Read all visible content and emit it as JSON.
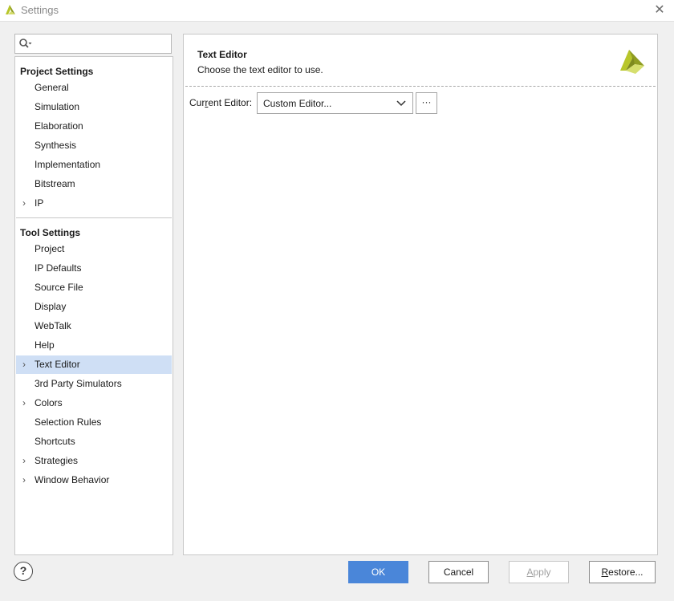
{
  "window": {
    "title": "Settings"
  },
  "search": {
    "placeholder": ""
  },
  "project_settings": {
    "header": "Project Settings",
    "items": [
      {
        "label": "General"
      },
      {
        "label": "Simulation"
      },
      {
        "label": "Elaboration"
      },
      {
        "label": "Synthesis"
      },
      {
        "label": "Implementation"
      },
      {
        "label": "Bitstream"
      },
      {
        "label": "IP",
        "expandable": true
      }
    ]
  },
  "tool_settings": {
    "header": "Tool Settings",
    "items": [
      {
        "label": "Project"
      },
      {
        "label": "IP Defaults"
      },
      {
        "label": "Source File"
      },
      {
        "label": "Display"
      },
      {
        "label": "WebTalk"
      },
      {
        "label": "Help"
      },
      {
        "label": "Text Editor",
        "expandable": true,
        "selected": true
      },
      {
        "label": "3rd Party Simulators"
      },
      {
        "label": "Colors",
        "expandable": true
      },
      {
        "label": "Selection Rules"
      },
      {
        "label": "Shortcuts"
      },
      {
        "label": "Strategies",
        "expandable": true
      },
      {
        "label": "Window Behavior",
        "expandable": true
      }
    ]
  },
  "content": {
    "title": "Text Editor",
    "description": "Choose the text editor to use.",
    "editor_label_pre": "Cur",
    "editor_label_mnemonic": "r",
    "editor_label_post": "ent Editor:",
    "editor_value": "Custom Editor...",
    "browse_label": "···"
  },
  "buttons": {
    "help": "?",
    "ok": "OK",
    "cancel": "Cancel",
    "apply_mnemonic": "A",
    "apply_rest": "pply",
    "restore_mnemonic": "R",
    "restore_rest": "estore..."
  },
  "colors": {
    "selection": "#cfdff5",
    "ok_button": "#4a86d9",
    "logo_light": "#b8c62a",
    "logo_dark": "#7e8a1e"
  }
}
